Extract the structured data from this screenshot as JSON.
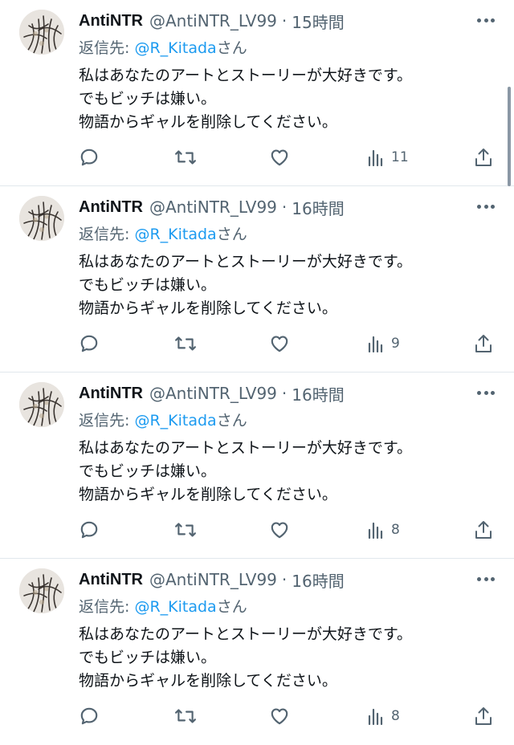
{
  "tweets": [
    {
      "name": "AntiNTR",
      "handle": "@AntiNTR_LV99",
      "dot": "·",
      "time": "15時間",
      "reply_prefix": "返信先: ",
      "reply_mention": "@R_Kitada",
      "reply_suffix": "さん",
      "lines": [
        "私はあなたのアートとストーリーが大好きです。",
        "でもビッチは嫌い。",
        "物語からギャルを削除してください。"
      ],
      "views": "11"
    },
    {
      "name": "AntiNTR",
      "handle": "@AntiNTR_LV99",
      "dot": "·",
      "time": "16時間",
      "reply_prefix": "返信先: ",
      "reply_mention": "@R_Kitada",
      "reply_suffix": "さん",
      "lines": [
        "私はあなたのアートとストーリーが大好きです。",
        "でもビッチは嫌い。",
        "物語からギャルを削除してください。"
      ],
      "views": "9"
    },
    {
      "name": "AntiNTR",
      "handle": "@AntiNTR_LV99",
      "dot": "·",
      "time": "16時間",
      "reply_prefix": "返信先: ",
      "reply_mention": "@R_Kitada",
      "reply_suffix": "さん",
      "lines": [
        "私はあなたのアートとストーリーが大好きです。",
        "でもビッチは嫌い。",
        "物語からギャルを削除してください。"
      ],
      "views": "8"
    },
    {
      "name": "AntiNTR",
      "handle": "@AntiNTR_LV99",
      "dot": "·",
      "time": "16時間",
      "reply_prefix": "返信先: ",
      "reply_mention": "@R_Kitada",
      "reply_suffix": "さん",
      "lines": [
        "私はあなたのアートとストーリーが大好きです。",
        "でもビッチは嫌い。",
        "物語からギャルを削除してください。"
      ],
      "views": "8"
    }
  ],
  "icons": {
    "reply": "reply-icon",
    "retweet": "retweet-icon",
    "like": "heart-icon",
    "views": "views-chart-icon",
    "share": "share-icon",
    "more": "more-options-icon"
  },
  "colors": {
    "text": "#0f1419",
    "secondary": "#536471",
    "link": "#1d9bf0",
    "divider": "#e1e8ed"
  }
}
